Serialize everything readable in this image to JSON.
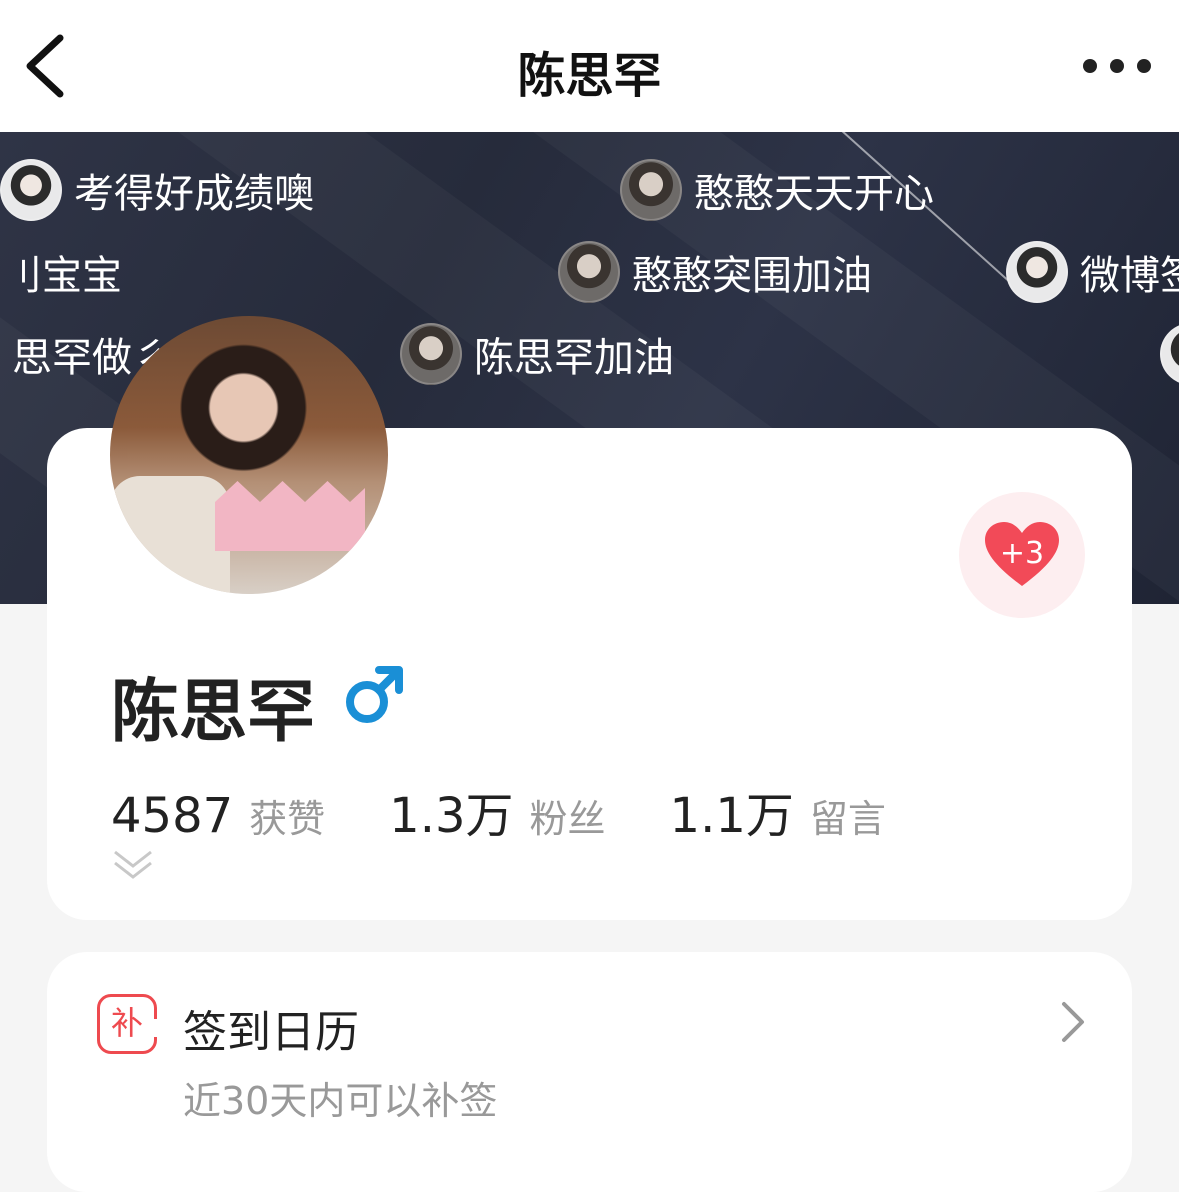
{
  "header": {
    "title": "陈思罕"
  },
  "danmaku": [
    {
      "text": "考得好成绩噢",
      "avatar": "light"
    },
    {
      "text": "憨憨天天开心",
      "avatar": "dark"
    },
    {
      "text": "刂宝宝",
      "avatar": "none"
    },
    {
      "text": "憨憨突围加油",
      "avatar": "dark"
    },
    {
      "text": "微博签",
      "avatar": "light"
    },
    {
      "text": "思罕做彳",
      "avatar": "none"
    },
    {
      "text": "陈思罕加油",
      "avatar": "dark"
    }
  ],
  "profile": {
    "name": "陈思罕",
    "gender_symbol": "♂",
    "heart_count": "+3",
    "stats": [
      {
        "value": "4587",
        "label": "获赞"
      },
      {
        "value": "1.3万",
        "label": "粉丝"
      },
      {
        "value": "1.1万",
        "label": "留言"
      }
    ]
  },
  "checkin": {
    "icon_char": "补",
    "title": "签到日历",
    "subtitle": "近30天内可以补签"
  },
  "colors": {
    "accent_red": "#ee4a4f",
    "male_blue": "#1a8fd6"
  }
}
